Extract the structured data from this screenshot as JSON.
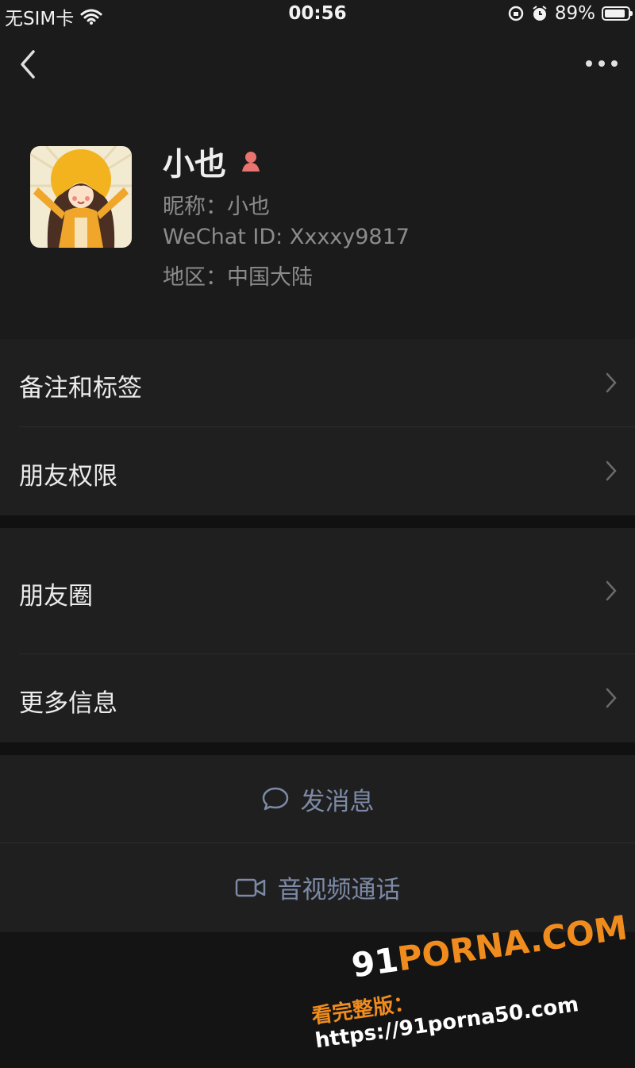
{
  "status_bar": {
    "carrier": "无SIM卡",
    "time": "00:56",
    "battery": "89%",
    "battery_level": 0.89
  },
  "profile": {
    "name": "小也",
    "nickname": "昵称：小也",
    "wechat_id": "WeChat ID: Xxxxy9817",
    "region": "地区：中国大陆",
    "gender_icon": "female-icon",
    "gender_color": "#e8736f"
  },
  "menu": {
    "remarks_tags": "备注和标签",
    "friend_permissions": "朋友权限",
    "moments": "朋友圈",
    "more_info": "更多信息"
  },
  "actions": {
    "send_message": "发消息",
    "video_call": "音视频通话"
  },
  "watermark": {
    "brand_prefix": "91",
    "brand_rest": "PORNA.COM",
    "line2_prefix": "看完整版：",
    "line2_url": "https://91porna50.com"
  },
  "colors": {
    "background": "#1b1b1b",
    "action_text": "#7d8aa6",
    "watermark": "#f08c1e"
  }
}
